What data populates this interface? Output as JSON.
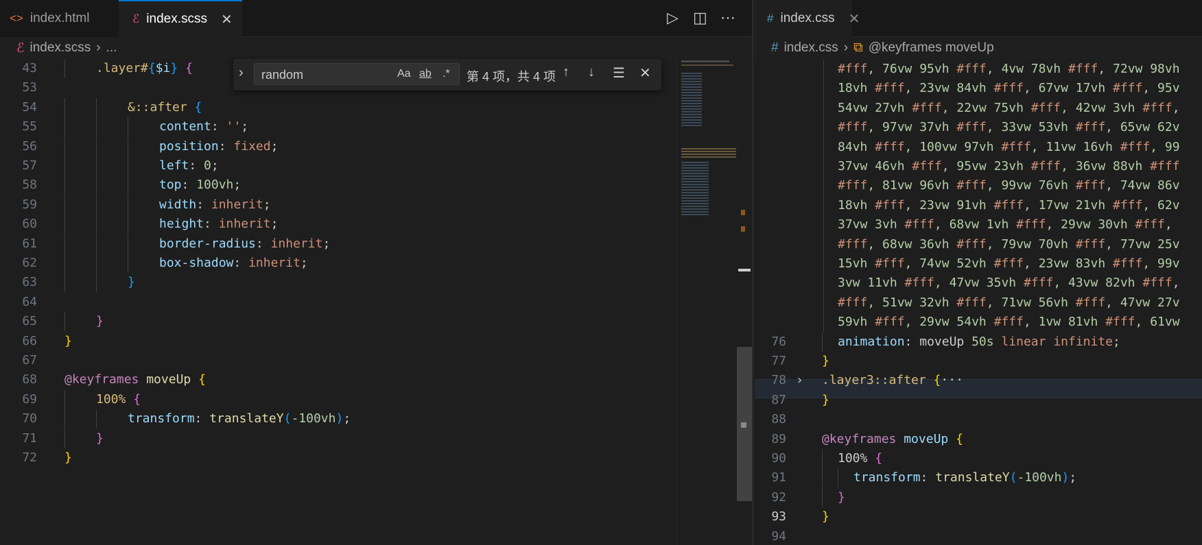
{
  "left": {
    "tabs": [
      {
        "label": "index.html",
        "icon": "html-file-icon",
        "active": false
      },
      {
        "label": "index.scss",
        "icon": "scss-file-icon",
        "active": true
      }
    ],
    "breadcrumb": {
      "file": "index.scss",
      "rest": "..."
    },
    "find": {
      "query": "random",
      "match_case": "Aa",
      "whole_word": "ab",
      "regex": ".*",
      "result": "第 4 项，共 4 项"
    },
    "lines": [
      {
        "n": "43",
        "indent": 1,
        "tokens": [
          [
            "sel",
            ".layer#"
          ],
          [
            "br3",
            "{"
          ],
          [
            "var",
            "$i"
          ],
          [
            "br3",
            "}"
          ],
          [
            "pun",
            " "
          ],
          [
            "br2",
            "{"
          ]
        ]
      },
      {
        "n": "53",
        "indent": 0,
        "tokens": []
      },
      {
        "n": "54",
        "indent": 2,
        "tokens": [
          [
            "amp",
            "&"
          ],
          [
            "sel",
            "::after"
          ],
          [
            "pun",
            " "
          ],
          [
            "br3",
            "{"
          ]
        ]
      },
      {
        "n": "55",
        "indent": 3,
        "tokens": [
          [
            "prop",
            "content"
          ],
          [
            "pun",
            ": "
          ],
          [
            "val",
            "''"
          ],
          [
            "pun",
            ";"
          ]
        ]
      },
      {
        "n": "56",
        "indent": 3,
        "tokens": [
          [
            "prop",
            "position"
          ],
          [
            "pun",
            ": "
          ],
          [
            "val",
            "fixed"
          ],
          [
            "pun",
            ";"
          ]
        ]
      },
      {
        "n": "57",
        "indent": 3,
        "tokens": [
          [
            "prop",
            "left"
          ],
          [
            "pun",
            ": "
          ],
          [
            "num",
            "0"
          ],
          [
            "pun",
            ";"
          ]
        ]
      },
      {
        "n": "58",
        "indent": 3,
        "tokens": [
          [
            "prop",
            "top"
          ],
          [
            "pun",
            ": "
          ],
          [
            "num",
            "100vh"
          ],
          [
            "pun",
            ";"
          ]
        ]
      },
      {
        "n": "59",
        "indent": 3,
        "tokens": [
          [
            "prop",
            "width"
          ],
          [
            "pun",
            ": "
          ],
          [
            "val",
            "inherit"
          ],
          [
            "pun",
            ";"
          ]
        ]
      },
      {
        "n": "60",
        "indent": 3,
        "tokens": [
          [
            "prop",
            "height"
          ],
          [
            "pun",
            ": "
          ],
          [
            "val",
            "inherit"
          ],
          [
            "pun",
            ";"
          ]
        ]
      },
      {
        "n": "61",
        "indent": 3,
        "tokens": [
          [
            "prop",
            "border-radius"
          ],
          [
            "pun",
            ": "
          ],
          [
            "val",
            "inherit"
          ],
          [
            "pun",
            ";"
          ]
        ]
      },
      {
        "n": "62",
        "indent": 3,
        "tokens": [
          [
            "prop",
            "box-shadow"
          ],
          [
            "pun",
            ": "
          ],
          [
            "val",
            "inherit"
          ],
          [
            "pun",
            ";"
          ]
        ]
      },
      {
        "n": "63",
        "indent": 2,
        "tokens": [
          [
            "br3",
            "}"
          ]
        ]
      },
      {
        "n": "64",
        "indent": 0,
        "tokens": []
      },
      {
        "n": "65",
        "indent": 1,
        "tokens": [
          [
            "br2",
            "}"
          ]
        ]
      },
      {
        "n": "66",
        "indent": 0,
        "tokens": [
          [
            "br1",
            "}"
          ]
        ]
      },
      {
        "n": "67",
        "indent": 0,
        "tokens": []
      },
      {
        "n": "68",
        "indent": 0,
        "tokens": [
          [
            "kw",
            "@keyframes"
          ],
          [
            "pun",
            " "
          ],
          [
            "fn",
            "moveUp"
          ],
          [
            "pun",
            " "
          ],
          [
            "br1",
            "{"
          ]
        ]
      },
      {
        "n": "69",
        "indent": 1,
        "tokens": [
          [
            "sel",
            "100%"
          ],
          [
            "pun",
            " "
          ],
          [
            "br2",
            "{"
          ]
        ]
      },
      {
        "n": "70",
        "indent": 2,
        "tokens": [
          [
            "prop",
            "transform"
          ],
          [
            "pun",
            ": "
          ],
          [
            "fn",
            "translateY"
          ],
          [
            "br3",
            "("
          ],
          [
            "num",
            "-100vh"
          ],
          [
            "br3",
            ")"
          ],
          [
            "pun",
            ";"
          ]
        ]
      },
      {
        "n": "71",
        "indent": 1,
        "tokens": [
          [
            "br2",
            "}"
          ]
        ]
      },
      {
        "n": "72",
        "indent": 0,
        "tokens": [
          [
            "br1",
            "}"
          ]
        ]
      }
    ]
  },
  "right": {
    "tab": {
      "label": "index.css",
      "icon": "css-file-icon"
    },
    "breadcrumb": {
      "file": "index.css",
      "symbol": "@keyframes moveUp"
    },
    "wrapped": [
      "#fff, 76vw 95vh #fff, 4vw 78vh #fff, 72vw 98vh",
      "18vh #fff, 23vw 84vh #fff, 67vw 17vh #fff, 95v",
      "54vw 27vh #fff, 22vw 75vh #fff, 42vw 3vh #fff,",
      "#fff, 97vw 37vh #fff, 33vw 53vh #fff, 65vw 62v",
      "84vh #fff, 100vw 97vh #fff, 11vw 16vh #fff, 99",
      "37vw 46vh #fff, 95vw 23vh #fff, 36vw 88vh #fff",
      "#fff, 81vw 96vh #fff, 99vw 76vh #fff, 74vw 86v",
      "18vh #fff, 23vw 91vh #fff, 17vw 21vh #fff, 62v",
      "37vw 3vh #fff, 68vw 1vh #fff, 29vw 30vh #fff,",
      "#fff, 68vw 36vh #fff, 79vw 70vh #fff, 77vw 25v",
      "15vh #fff, 74vw 52vh #fff, 23vw 83vh #fff, 99v",
      "3vw 11vh #fff, 47vw 35vh #fff, 43vw 82vh #fff,",
      "#fff, 51vw 32vh #fff, 71vw 56vh #fff, 47vw 27v",
      "59vh #fff, 29vw 54vh #fff, 1vw 81vh #fff, 61vw"
    ],
    "lines": [
      {
        "n": "76",
        "indent": 1,
        "tokens": [
          [
            "prop",
            "animation"
          ],
          [
            "pun",
            ": "
          ],
          [
            "pun",
            "moveUp "
          ],
          [
            "num",
            "50s"
          ],
          [
            "pun",
            " "
          ],
          [
            "val",
            "linear"
          ],
          [
            "pun",
            " "
          ],
          [
            "val",
            "infinite"
          ],
          [
            "pun",
            ";"
          ]
        ]
      },
      {
        "n": "77",
        "indent": 0,
        "tokens": [
          [
            "br1",
            "}"
          ]
        ]
      },
      {
        "n": "78",
        "indent": 0,
        "tokens": [
          [
            "sel",
            ".layer3::after"
          ],
          [
            "pun",
            " "
          ],
          [
            "br1",
            "{"
          ],
          [
            "pun",
            "···"
          ]
        ],
        "folded": true
      },
      {
        "n": "87",
        "indent": 0,
        "tokens": [
          [
            "br1",
            "}"
          ]
        ]
      },
      {
        "n": "88",
        "indent": 0,
        "tokens": []
      },
      {
        "n": "89",
        "indent": 0,
        "tokens": [
          [
            "kw",
            "@keyframes"
          ],
          [
            "pun",
            " "
          ],
          [
            "var",
            "moveUp"
          ],
          [
            "pun",
            " "
          ],
          [
            "br1",
            "{"
          ]
        ]
      },
      {
        "n": "90",
        "indent": 1,
        "tokens": [
          [
            "pun",
            "100%"
          ],
          [
            "pun",
            " "
          ],
          [
            "br2",
            "{"
          ]
        ]
      },
      {
        "n": "91",
        "indent": 2,
        "tokens": [
          [
            "prop",
            "transform"
          ],
          [
            "pun",
            ": "
          ],
          [
            "fn",
            "translateY"
          ],
          [
            "br3",
            "("
          ],
          [
            "num",
            "-100vh"
          ],
          [
            "br3",
            ")"
          ],
          [
            "pun",
            ";"
          ]
        ]
      },
      {
        "n": "92",
        "indent": 1,
        "tokens": [
          [
            "br2",
            "}"
          ]
        ]
      },
      {
        "n": "93",
        "indent": 0,
        "tokens": [
          [
            "br1",
            "}"
          ]
        ],
        "current": true
      },
      {
        "n": "94",
        "indent": 0,
        "tokens": []
      }
    ]
  }
}
